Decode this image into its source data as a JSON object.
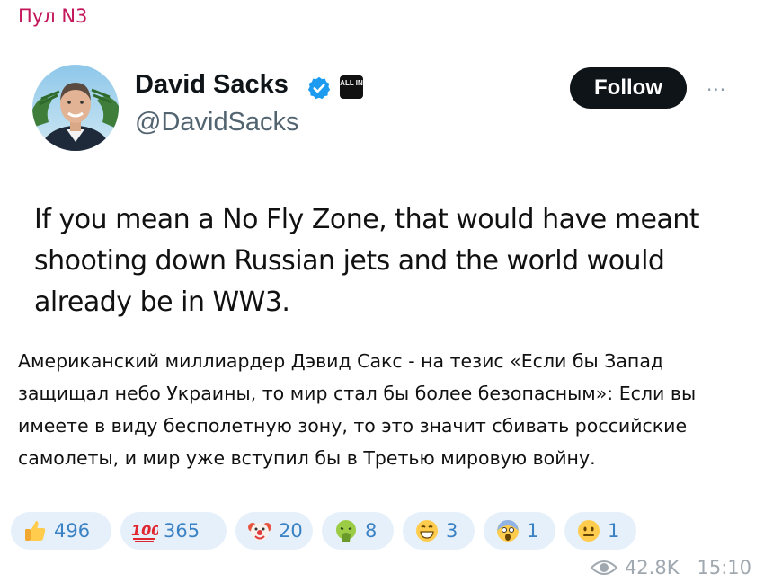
{
  "channel": {
    "name": "Пул N3"
  },
  "tweet": {
    "author_name": "David Sacks",
    "handle": "@DavidSacks",
    "badge_text": "ALL IN",
    "follow_label": "Follow",
    "more_label": "···",
    "text": "If you mean a No Fly Zone, that would have meant shooting down Russian jets and the world would already be in WW3."
  },
  "post": {
    "caption": "Американский миллиардер Дэвид Сакс - на тезис «Если бы Запад защищал небо Украины, то мир стал бы более безопасным»: Если вы имеете в виду бесполетную зону, то это значит сбивать российские самолеты, и мир уже вступил бы в Третью мировую войну.",
    "views": "42.8K",
    "time": "15:10"
  },
  "reactions": [
    {
      "emoji": "thumbs-up-icon",
      "count": "496"
    },
    {
      "emoji": "hundred-points-icon",
      "count": "365"
    },
    {
      "emoji": "clown-face-icon",
      "count": "20"
    },
    {
      "emoji": "nauseated-face-icon",
      "count": "8"
    },
    {
      "emoji": "grinning-face-icon",
      "count": "3"
    },
    {
      "emoji": "screaming-face-icon",
      "count": "1"
    },
    {
      "emoji": "neutral-face-icon",
      "count": "1"
    }
  ],
  "colors": {
    "channel_name": "#c2185b",
    "verified": "#1d9bf0",
    "reaction_bg": "#e6f0fa",
    "reaction_text": "#3b82c4"
  }
}
